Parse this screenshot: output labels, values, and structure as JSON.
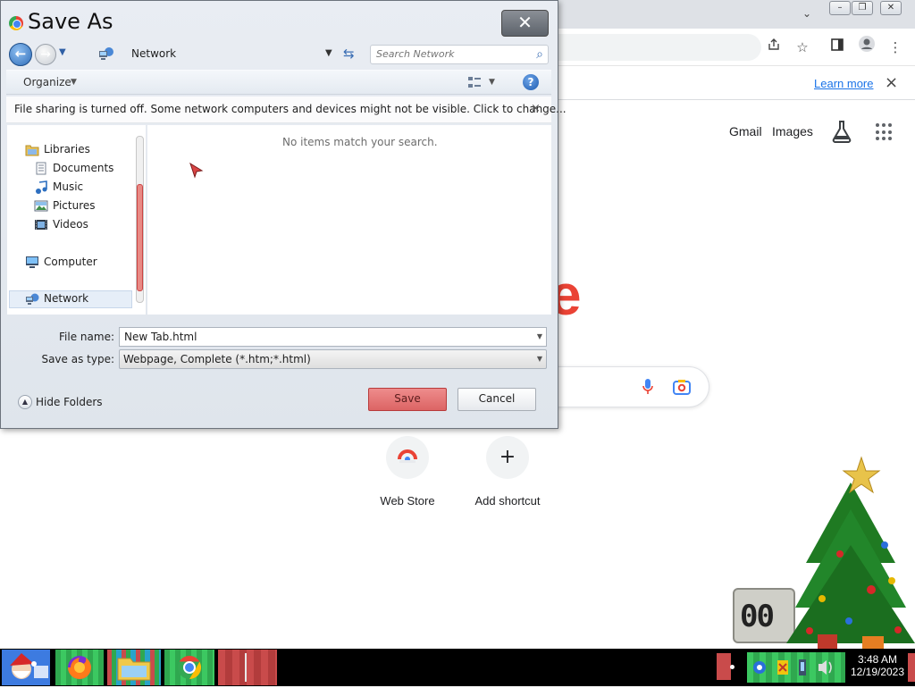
{
  "browser": {
    "learn_more": "Learn more",
    "infobar_close": "×",
    "links": {
      "gmail": "Gmail",
      "images": "Images"
    },
    "logo_fragment": "e",
    "shortcuts": [
      {
        "label": "Web Store",
        "icon": "chrome-webstore-icon"
      },
      {
        "label": "Add shortcut",
        "icon": "plus-icon",
        "glyph": "+"
      }
    ]
  },
  "dialog": {
    "title": "Save As",
    "close_glyph": "✕",
    "address": "Network",
    "search_placeholder": "Search Network",
    "organize": "Organize",
    "sharing_message": "File sharing is turned off. Some network computers and devices might not be visible. Click to change...",
    "sharing_close": "×",
    "nav": {
      "libraries": "Libraries",
      "documents": "Documents",
      "music": "Music",
      "pictures": "Pictures",
      "videos": "Videos",
      "computer": "Computer",
      "network": "Network"
    },
    "empty_message": "No items match your search.",
    "file_name_label": "File name:",
    "file_name_value": "New Tab.html",
    "save_type_label": "Save as type:",
    "save_type_value": "Webpage, Complete (*.htm;*.html)",
    "hide_folders": "Hide Folders",
    "save": "Save",
    "cancel": "Cancel"
  },
  "widget": {
    "clock_digits": "00"
  },
  "taskbar": {
    "time": "3:48 AM",
    "date": "12/19/2023",
    "apps": [
      "santa-start-icon",
      "firefox-icon",
      "file-explorer-icon",
      "chrome-icon"
    ]
  },
  "colors": {
    "accent_red": "#dc6464",
    "link_blue": "#1a73e8",
    "taskbar": "#000000"
  }
}
